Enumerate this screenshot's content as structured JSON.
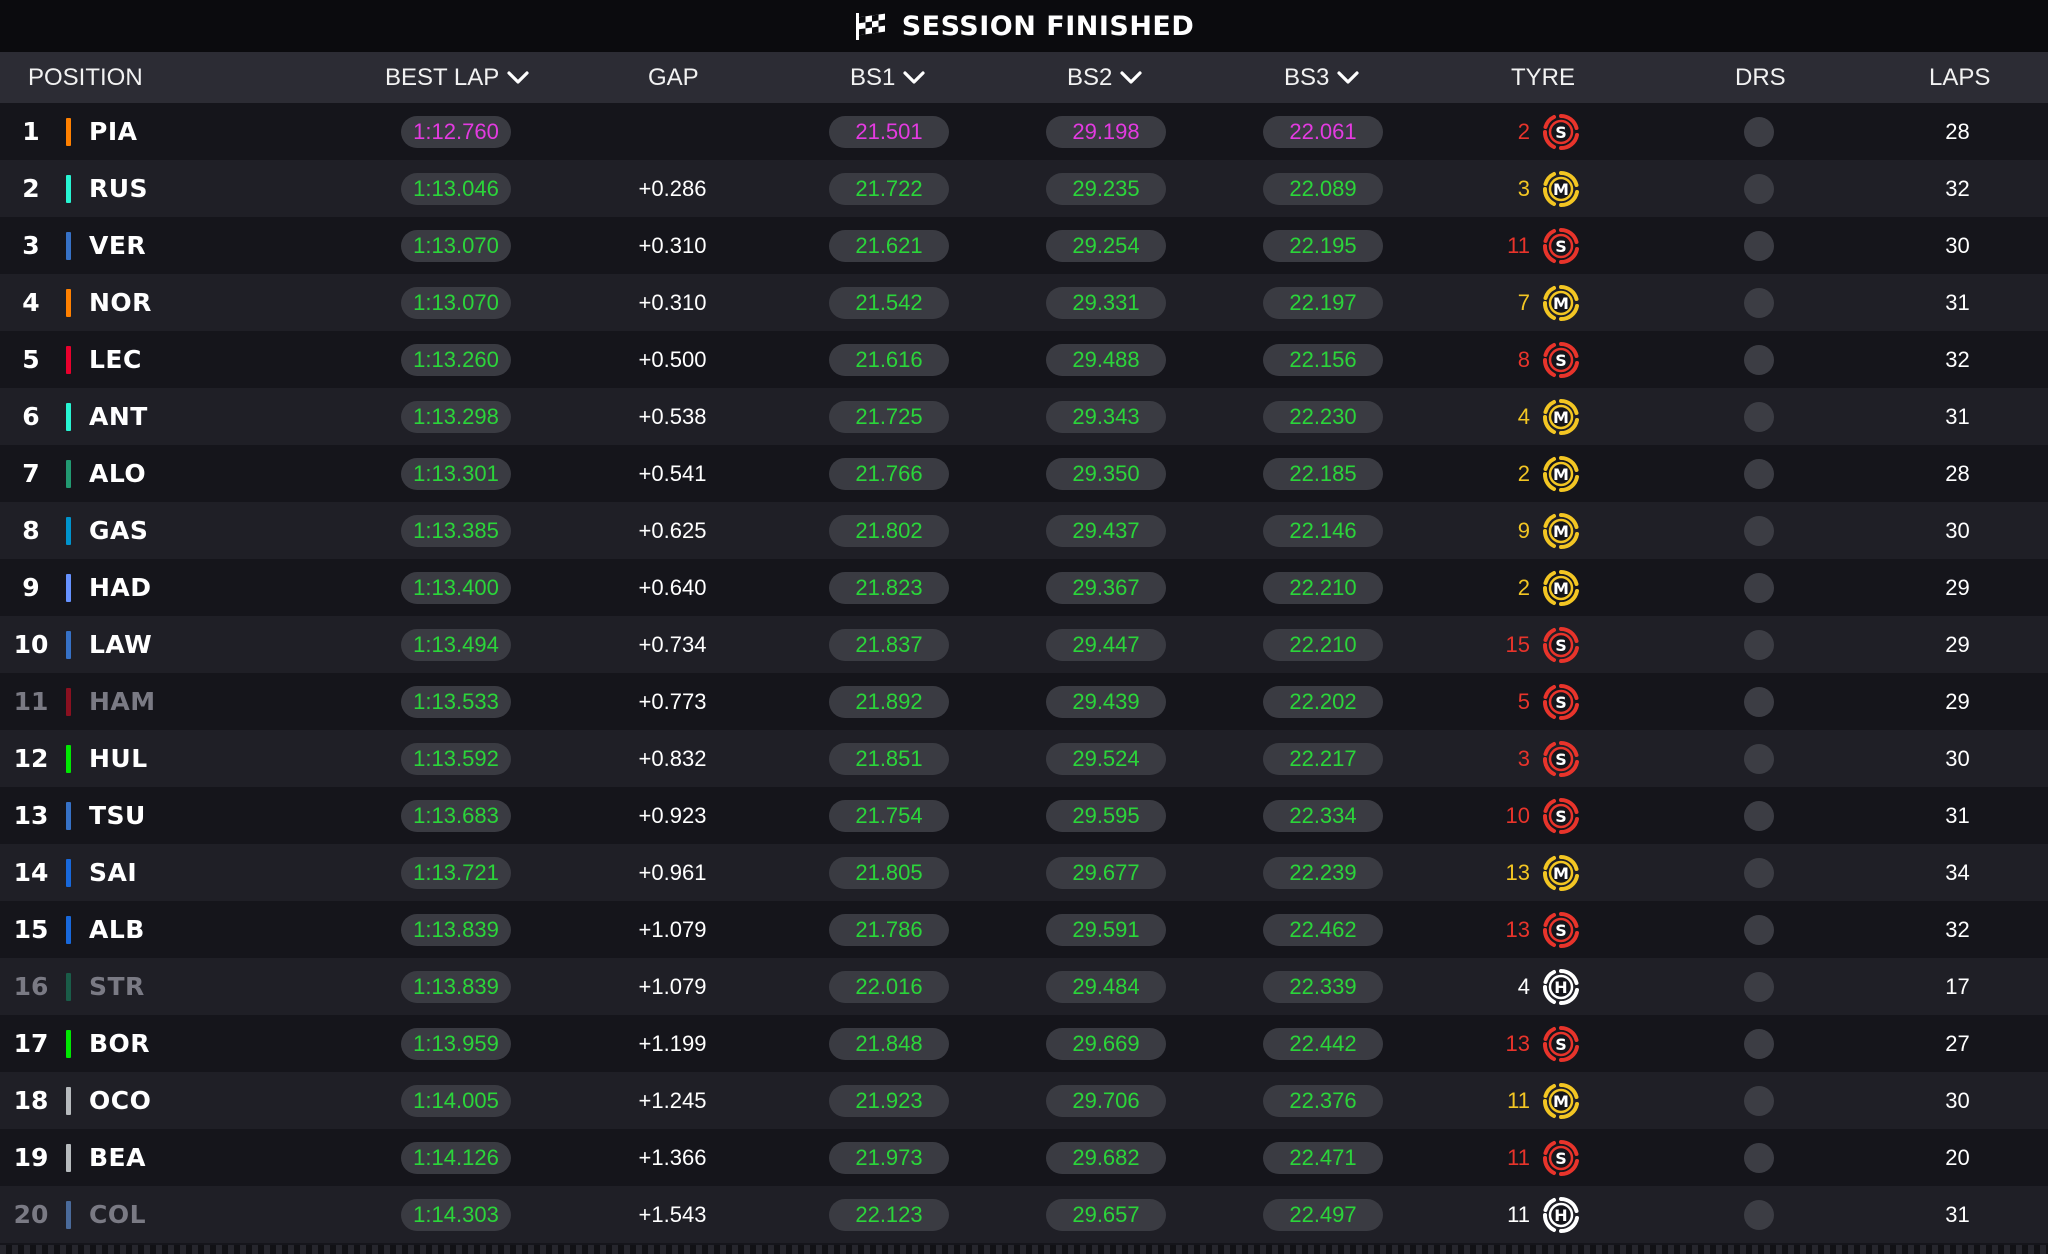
{
  "banner": {
    "title": "SESSION FINISHED",
    "icon": "checkered-flag-icon"
  },
  "columns": {
    "position": "POSITION",
    "best_lap": "BEST LAP",
    "gap": "GAP",
    "bs1": "BS1",
    "bs2": "BS2",
    "bs3": "BS3",
    "tyre": "TYRE",
    "drs": "DRS",
    "laps": "LAPS"
  },
  "colors": {
    "green": "#2bd53a",
    "purple": "#e33be0",
    "soft": "#e8342b",
    "medium": "#f3c623",
    "hard": "#ffffff"
  },
  "drivers": [
    {
      "pos": "1",
      "code": "PIA",
      "team_color": "#ff8000",
      "best_lap": "1:12.760",
      "best_lap_purple": true,
      "gap": "",
      "bs1": "21.501",
      "bs2": "29.198",
      "bs3": "22.061",
      "sectors_purple": true,
      "tyre_age": "2",
      "tyre": "S",
      "laps": "28",
      "dim": false
    },
    {
      "pos": "2",
      "code": "RUS",
      "team_color": "#27f4d2",
      "best_lap": "1:13.046",
      "gap": "+0.286",
      "bs1": "21.722",
      "bs2": "29.235",
      "bs3": "22.089",
      "tyre_age": "3",
      "tyre": "M",
      "laps": "32",
      "dim": false
    },
    {
      "pos": "3",
      "code": "VER",
      "team_color": "#3671c6",
      "best_lap": "1:13.070",
      "gap": "+0.310",
      "bs1": "21.621",
      "bs2": "29.254",
      "bs3": "22.195",
      "tyre_age": "11",
      "tyre": "S",
      "laps": "30",
      "dim": false
    },
    {
      "pos": "4",
      "code": "NOR",
      "team_color": "#ff8000",
      "best_lap": "1:13.070",
      "gap": "+0.310",
      "bs1": "21.542",
      "bs2": "29.331",
      "bs3": "22.197",
      "tyre_age": "7",
      "tyre": "M",
      "laps": "31",
      "dim": false
    },
    {
      "pos": "5",
      "code": "LEC",
      "team_color": "#e8002d",
      "best_lap": "1:13.260",
      "gap": "+0.500",
      "bs1": "21.616",
      "bs2": "29.488",
      "bs3": "22.156",
      "tyre_age": "8",
      "tyre": "S",
      "laps": "32",
      "dim": false
    },
    {
      "pos": "6",
      "code": "ANT",
      "team_color": "#27f4d2",
      "best_lap": "1:13.298",
      "gap": "+0.538",
      "bs1": "21.725",
      "bs2": "29.343",
      "bs3": "22.230",
      "tyre_age": "4",
      "tyre": "M",
      "laps": "31",
      "dim": false
    },
    {
      "pos": "7",
      "code": "ALO",
      "team_color": "#229971",
      "best_lap": "1:13.301",
      "gap": "+0.541",
      "bs1": "21.766",
      "bs2": "29.350",
      "bs3": "22.185",
      "tyre_age": "2",
      "tyre": "M",
      "laps": "28",
      "dim": false
    },
    {
      "pos": "8",
      "code": "GAS",
      "team_color": "#0093cc",
      "best_lap": "1:13.385",
      "gap": "+0.625",
      "bs1": "21.802",
      "bs2": "29.437",
      "bs3": "22.146",
      "tyre_age": "9",
      "tyre": "M",
      "laps": "30",
      "dim": false
    },
    {
      "pos": "9",
      "code": "HAD",
      "team_color": "#6692ff",
      "best_lap": "1:13.400",
      "gap": "+0.640",
      "bs1": "21.823",
      "bs2": "29.367",
      "bs3": "22.210",
      "tyre_age": "2",
      "tyre": "M",
      "laps": "29",
      "dim": false
    },
    {
      "pos": "10",
      "code": "LAW",
      "team_color": "#3671c6",
      "best_lap": "1:13.494",
      "gap": "+0.734",
      "bs1": "21.837",
      "bs2": "29.447",
      "bs3": "22.210",
      "tyre_age": "15",
      "tyre": "S",
      "laps": "29",
      "dim": false
    },
    {
      "pos": "11",
      "code": "HAM",
      "team_color": "#8a1020",
      "best_lap": "1:13.533",
      "gap": "+0.773",
      "bs1": "21.892",
      "bs2": "29.439",
      "bs3": "22.202",
      "tyre_age": "5",
      "tyre": "S",
      "laps": "29",
      "dim": true
    },
    {
      "pos": "12",
      "code": "HUL",
      "team_color": "#00e701",
      "best_lap": "1:13.592",
      "gap": "+0.832",
      "bs1": "21.851",
      "bs2": "29.524",
      "bs3": "22.217",
      "tyre_age": "3",
      "tyre": "S",
      "laps": "30",
      "dim": false
    },
    {
      "pos": "13",
      "code": "TSU",
      "team_color": "#3671c6",
      "best_lap": "1:13.683",
      "gap": "+0.923",
      "bs1": "21.754",
      "bs2": "29.595",
      "bs3": "22.334",
      "tyre_age": "10",
      "tyre": "S",
      "laps": "31",
      "dim": false
    },
    {
      "pos": "14",
      "code": "SAI",
      "team_color": "#1868db",
      "best_lap": "1:13.721",
      "gap": "+0.961",
      "bs1": "21.805",
      "bs2": "29.677",
      "bs3": "22.239",
      "tyre_age": "13",
      "tyre": "M",
      "laps": "34",
      "dim": false
    },
    {
      "pos": "15",
      "code": "ALB",
      "team_color": "#1868db",
      "best_lap": "1:13.839",
      "gap": "+1.079",
      "bs1": "21.786",
      "bs2": "29.591",
      "bs3": "22.462",
      "tyre_age": "13",
      "tyre": "S",
      "laps": "32",
      "dim": false
    },
    {
      "pos": "16",
      "code": "STR",
      "team_color": "#1a5c48",
      "best_lap": "1:13.839",
      "gap": "+1.079",
      "bs1": "22.016",
      "bs2": "29.484",
      "bs3": "22.339",
      "tyre_age": "4",
      "tyre": "H",
      "laps": "17",
      "dim": true
    },
    {
      "pos": "17",
      "code": "BOR",
      "team_color": "#00e701",
      "best_lap": "1:13.959",
      "gap": "+1.199",
      "bs1": "21.848",
      "bs2": "29.669",
      "bs3": "22.442",
      "tyre_age": "13",
      "tyre": "S",
      "laps": "27",
      "dim": false
    },
    {
      "pos": "18",
      "code": "OCO",
      "team_color": "#b6babd",
      "best_lap": "1:14.005",
      "gap": "+1.245",
      "bs1": "21.923",
      "bs2": "29.706",
      "bs3": "22.376",
      "tyre_age": "11",
      "tyre": "M",
      "laps": "30",
      "dim": false
    },
    {
      "pos": "19",
      "code": "BEA",
      "team_color": "#b6babd",
      "best_lap": "1:14.126",
      "gap": "+1.366",
      "bs1": "21.973",
      "bs2": "29.682",
      "bs3": "22.471",
      "tyre_age": "11",
      "tyre": "S",
      "laps": "20",
      "dim": false
    },
    {
      "pos": "20",
      "code": "COL",
      "team_color": "#4a6a9a",
      "best_lap": "1:14.303",
      "gap": "+1.543",
      "bs1": "22.123",
      "bs2": "29.657",
      "bs3": "22.497",
      "tyre_age": "11",
      "tyre": "H",
      "laps": "31",
      "dim": true
    }
  ]
}
